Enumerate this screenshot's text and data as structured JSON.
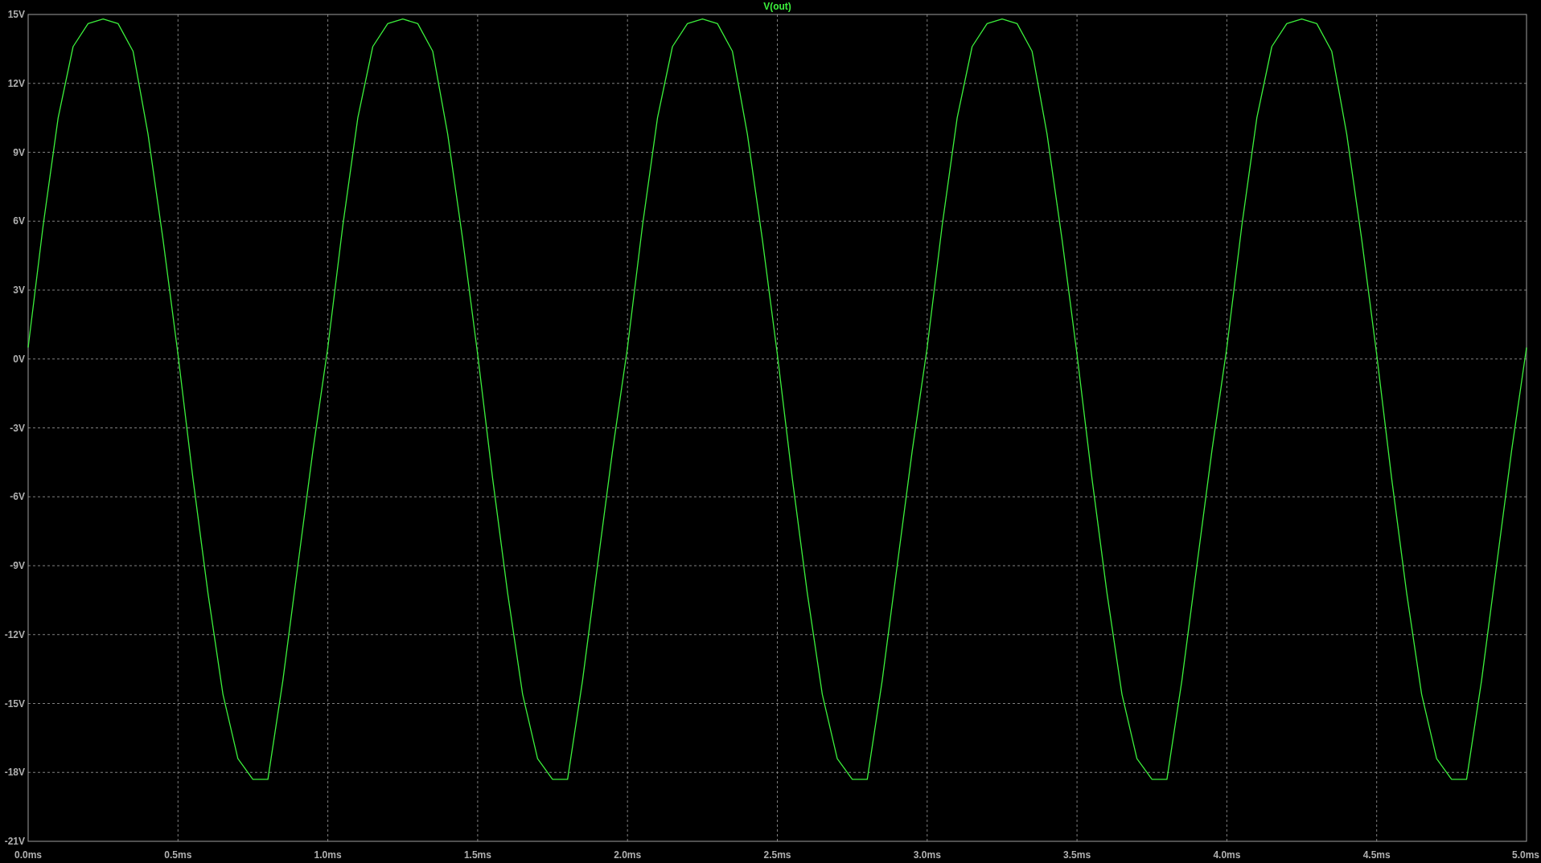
{
  "plot": {
    "chart_data": {
      "type": "line",
      "grid": true,
      "x": [
        0,
        0.05,
        0.1,
        0.15,
        0.2,
        0.25,
        0.3,
        0.35,
        0.4,
        0.45,
        0.5,
        0.55,
        0.6,
        0.65,
        0.7,
        0.75,
        0.8,
        0.85,
        0.9,
        0.95,
        1,
        1.05,
        1.1,
        1.15,
        1.2,
        1.25,
        1.3,
        1.35,
        1.4,
        1.45,
        1.5,
        1.55,
        1.6,
        1.65,
        1.7,
        1.75,
        1.8,
        1.85,
        1.9,
        1.95,
        2,
        2.05,
        2.1,
        2.15,
        2.2,
        2.25,
        2.3,
        2.35,
        2.4,
        2.45,
        2.5,
        2.55,
        2.6,
        2.65,
        2.7,
        2.75,
        2.8,
        2.85,
        2.9,
        2.95,
        3,
        3.05,
        3.1,
        3.15,
        3.2,
        3.25,
        3.3,
        3.35,
        3.4,
        3.45,
        3.5,
        3.55,
        3.6,
        3.65,
        3.7,
        3.75,
        3.8,
        3.85,
        3.9,
        3.95,
        4,
        4.05,
        4.1,
        4.15,
        4.2,
        4.25,
        4.3,
        4.35,
        4.4,
        4.45,
        4.5,
        4.55,
        4.6,
        4.65,
        4.7,
        4.75,
        4.8,
        4.85,
        4.9,
        4.95,
        5
      ],
      "series": [
        {
          "name": "V(out)",
          "color": "#3cf03c",
          "values": [
            0.5,
            5.8,
            10.5,
            13.6,
            14.6,
            14.8,
            14.6,
            13.4,
            9.8,
            5.2,
            0.2,
            -5.2,
            -10.2,
            -14.6,
            -17.4,
            -18.3,
            -18.3,
            -14,
            -9,
            -4,
            0.5,
            5.8,
            10.5,
            13.6,
            14.6,
            14.8,
            14.6,
            13.4,
            9.8,
            5.2,
            0.2,
            -5.2,
            -10.2,
            -14.6,
            -17.4,
            -18.3,
            -18.3,
            -14,
            -9,
            -4,
            0.5,
            5.8,
            10.5,
            13.6,
            14.6,
            14.8,
            14.6,
            13.4,
            9.8,
            5.2,
            0.2,
            -5.2,
            -10.2,
            -14.6,
            -17.4,
            -18.3,
            -18.3,
            -14,
            -9,
            -4,
            0.5,
            5.8,
            10.5,
            13.6,
            14.6,
            14.8,
            14.6,
            13.4,
            9.8,
            5.2,
            0.2,
            -5.2,
            -10.2,
            -14.6,
            -17.4,
            -18.3,
            -18.3,
            -14,
            -9,
            -4,
            0.5,
            5.8,
            10.5,
            13.6,
            14.6,
            14.8,
            14.6,
            13.4,
            9.8,
            5.2,
            0.2,
            -5.2,
            -10.2,
            -14.6,
            -17.4,
            -18.3,
            -18.3,
            -14,
            -9,
            -4,
            0.5
          ]
        }
      ],
      "xlim": [
        0,
        5
      ],
      "ylim": [
        -21,
        15
      ],
      "xticks": [
        {
          "value": 0,
          "label": "0.0ms"
        },
        {
          "value": 0.5,
          "label": "0.5ms"
        },
        {
          "value": 1,
          "label": "1.0ms"
        },
        {
          "value": 1.5,
          "label": "1.5ms"
        },
        {
          "value": 2,
          "label": "2.0ms"
        },
        {
          "value": 2.5,
          "label": "2.5ms"
        },
        {
          "value": 3,
          "label": "3.0ms"
        },
        {
          "value": 3.5,
          "label": "3.5ms"
        },
        {
          "value": 4,
          "label": "4.0ms"
        },
        {
          "value": 4.5,
          "label": "4.5ms"
        },
        {
          "value": 5,
          "label": "5.0ms"
        }
      ],
      "yticks": [
        {
          "value": 15,
          "label": "15V"
        },
        {
          "value": 12,
          "label": "12V"
        },
        {
          "value": 9,
          "label": "9V"
        },
        {
          "value": 6,
          "label": "6V"
        },
        {
          "value": 3,
          "label": "3V"
        },
        {
          "value": 0,
          "label": "0V"
        },
        {
          "value": -3,
          "label": "-3V"
        },
        {
          "value": -6,
          "label": "-6V"
        },
        {
          "value": -9,
          "label": "-9V"
        },
        {
          "value": -12,
          "label": "-12V"
        },
        {
          "value": -15,
          "label": "-15V"
        },
        {
          "value": -18,
          "label": "-18V"
        },
        {
          "value": -21,
          "label": "-21V"
        }
      ]
    }
  }
}
